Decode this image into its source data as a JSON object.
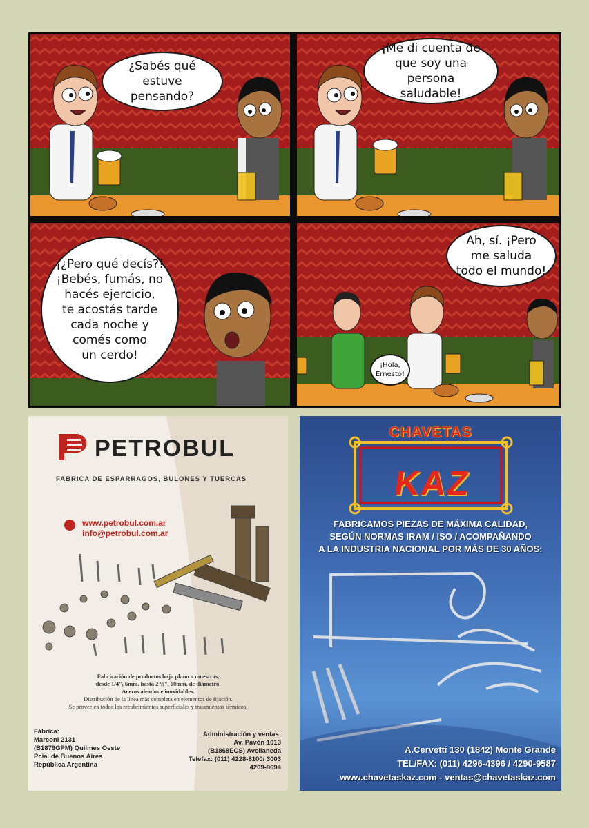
{
  "comic": {
    "panels": [
      {
        "bubble": "¿Sabés qué\nestuve pensando?"
      },
      {
        "bubble": "¡Me di cuenta de\nque soy una persona\nsaludable!"
      },
      {
        "bubble": "¡¿Pero qué decís?!\n¡Bebés, fumás, no\nhacés ejercicio,\nte acostás tarde\ncada noche y\ncomés como\nun cerdo!"
      },
      {
        "bubble": "Ah, sí. ¡Pero\nme saluda\ntodo el mundo!",
        "small_bubble": "¡Hola,\nErnesto!"
      }
    ]
  },
  "ads": {
    "petrobul": {
      "brand": "PETROBUL",
      "subtitle": "FABRICA DE ESPARRAGOS, BULONES Y TUERCAS",
      "web": "www.petrobul.com.ar",
      "email": "info@petrobul.com.ar",
      "desc1": "Fabricación de productos bajo plano o muestras,",
      "desc2": "desde 1/4\", 6mm. hasta 2 ½\", 60mm. de diámetro.",
      "desc3": "Aceros aleados e inoxidables.",
      "desc4": "Distribución de la línea más completa en elementos de fijación.",
      "desc5": "Se provee en todos los recubrimientos superficiales y tratamientos térmicos.",
      "factory_label": "Fábrica:",
      "factory_addr1": "Marconi 2131",
      "factory_addr2": "(B1879GPM) Quilmes Oeste",
      "factory_addr3": "Pcia. de Buenos Aires",
      "factory_addr4": "República Argentina",
      "admin_label": "Administración y ventas:",
      "admin_addr1": "Av. Pavón 1013",
      "admin_addr2": "(B1868ECS) Avellaneda",
      "admin_phone": "Telefax: (011) 4228-8100/ 3003",
      "admin_phone2": "4209-9694"
    },
    "kaz": {
      "top": "CHAVETAS",
      "logo": "KAZ",
      "tag1": "FABRICAMOS PIEZAS DE MÁXIMA CALIDAD,",
      "tag2": "SEGÚN NORMAS IRAM / ISO / ACOMPAÑANDO",
      "tag3": "A LA INDUSTRIA NACIONAL POR MÁS DE 30 AÑOS:",
      "address": "A.Cervetti 130 (1842) Monte Grande",
      "phone": "TEL/FAX: (011) 4296-4396 / 4290-9587",
      "web": "www.chavetaskaz.com - ventas@chavetaskaz.com"
    }
  },
  "colors": {
    "wall": "#a51e1e",
    "bar_green": "#3c5b1f",
    "counter": "#e9962e",
    "page_bg": "#d3d6b4"
  }
}
